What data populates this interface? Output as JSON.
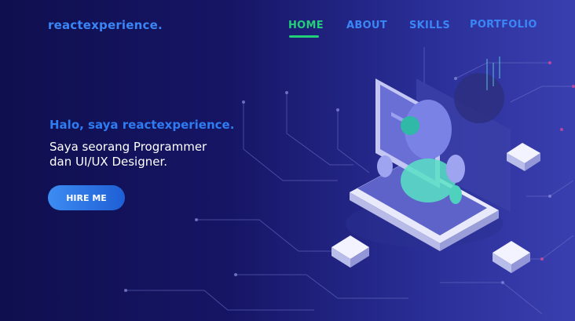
{
  "brand": "reactexperience.",
  "nav": {
    "home": "HOME",
    "about": "ABOUT",
    "skills": "SKILLS",
    "portfolio": "PORTFOLIO"
  },
  "hero": {
    "greeting": "Halo, saya reactexperience.",
    "role_line1": "Saya seorang Programmer",
    "role_line2": "dan UI/UX Designer.",
    "button_label": "HIRE ME"
  },
  "colors": {
    "accent": "#3b86f6",
    "active": "#22d07a",
    "background": "#151463"
  },
  "icons": [
    "laptop-illustration",
    "robot-illustration",
    "circuit-lines",
    "server-cube"
  ]
}
